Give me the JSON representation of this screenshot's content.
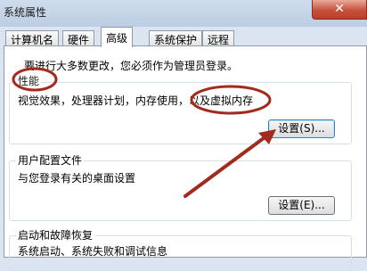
{
  "window": {
    "title": "系统属性",
    "close_label": "✕"
  },
  "tabs": [
    {
      "label": "计算机名",
      "active": false
    },
    {
      "label": "硬件",
      "active": false
    },
    {
      "label": "高级",
      "active": true
    },
    {
      "label": "系统保护",
      "active": false
    },
    {
      "label": "远程",
      "active": false
    }
  ],
  "notice": "要进行大多数更改，您必须作为管理员登录。",
  "performance": {
    "title": "性能",
    "description": "视觉效果，处理器计划，内存使用，以及虚拟内存",
    "button": "设置(S)..."
  },
  "user_profiles": {
    "title": "用户配置文件",
    "description": "与您登录有关的桌面设置",
    "button": "设置(E)..."
  },
  "startup_recovery": {
    "title": "启动和故障恢复",
    "description": "系统启动、系统失败和调试信息"
  },
  "annotation": {
    "color": "#a32a1e"
  }
}
